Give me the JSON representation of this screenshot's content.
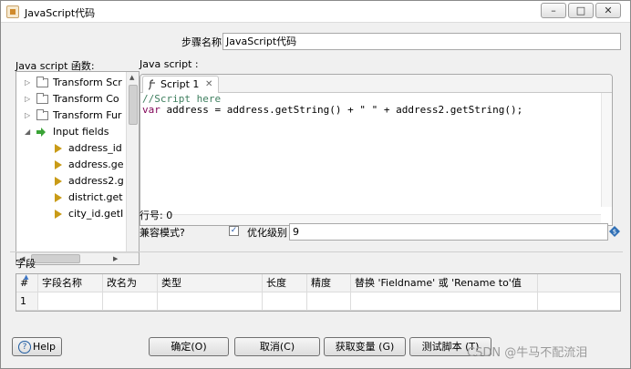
{
  "window": {
    "title": "JavaScript代码",
    "controls": [
      "–",
      "□",
      "✕"
    ]
  },
  "step_name": {
    "label": "步骤名称",
    "value": "JavaScript代码"
  },
  "functions_panel": {
    "label": "Java script 函数:",
    "items": [
      {
        "label": "Transform Scr",
        "kind": "folder"
      },
      {
        "label": "Transform Co",
        "kind": "folder"
      },
      {
        "label": "Transform Fur",
        "kind": "folder"
      },
      {
        "label": "Input fields",
        "kind": "input"
      },
      {
        "label": "address_id",
        "kind": "field"
      },
      {
        "label": "address.ge",
        "kind": "field"
      },
      {
        "label": "address2.g",
        "kind": "field"
      },
      {
        "label": "district.get",
        "kind": "field"
      },
      {
        "label": "city_id.getI",
        "kind": "field"
      }
    ]
  },
  "script_panel": {
    "label": "Java script :",
    "tab_label": "Script 1",
    "code_comment": "//Script here",
    "code_keyword": "var",
    "code_rest": " address = address.getString() + \" \" + address2.getString();"
  },
  "line_number": "行号: 0",
  "compat": {
    "label": "兼容模式?",
    "checked": true,
    "check_mark": "✓",
    "optimize_label": "优化级别",
    "optimize_value": "9"
  },
  "fields_section": {
    "label": "字段",
    "columns": [
      "#",
      "字段名称",
      "改名为",
      "类型",
      "长度",
      "精度",
      "替换 'Fieldname' 或 'Rename to'值"
    ],
    "rows": [
      [
        "1",
        "",
        "",
        "",
        "",
        "",
        ""
      ]
    ]
  },
  "buttons": {
    "help": "Help",
    "help_icon": "?",
    "ok": "确定(O)",
    "cancel": "取消(C)",
    "get_vars": "获取变量 (G)",
    "test": "测试脚本 (T)"
  },
  "watermark": "CSDN @牛马不配流泪"
}
